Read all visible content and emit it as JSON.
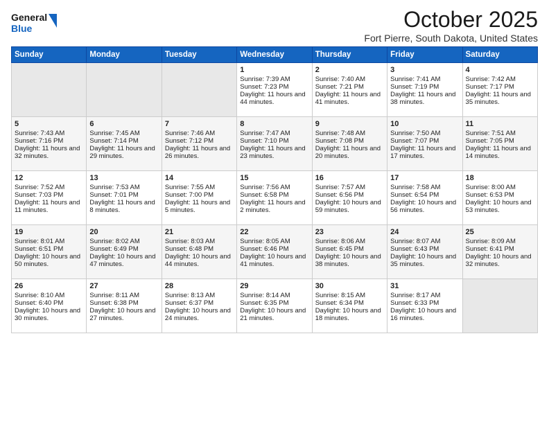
{
  "header": {
    "logo_general": "General",
    "logo_blue": "Blue",
    "month_title": "October 2025",
    "location": "Fort Pierre, South Dakota, United States"
  },
  "weekdays": [
    "Sunday",
    "Monday",
    "Tuesday",
    "Wednesday",
    "Thursday",
    "Friday",
    "Saturday"
  ],
  "weeks": [
    [
      {
        "day": "",
        "empty": true
      },
      {
        "day": "",
        "empty": true
      },
      {
        "day": "",
        "empty": true
      },
      {
        "day": "1",
        "sunrise": "Sunrise: 7:39 AM",
        "sunset": "Sunset: 7:23 PM",
        "daylight": "Daylight: 11 hours and 44 minutes."
      },
      {
        "day": "2",
        "sunrise": "Sunrise: 7:40 AM",
        "sunset": "Sunset: 7:21 PM",
        "daylight": "Daylight: 11 hours and 41 minutes."
      },
      {
        "day": "3",
        "sunrise": "Sunrise: 7:41 AM",
        "sunset": "Sunset: 7:19 PM",
        "daylight": "Daylight: 11 hours and 38 minutes."
      },
      {
        "day": "4",
        "sunrise": "Sunrise: 7:42 AM",
        "sunset": "Sunset: 7:17 PM",
        "daylight": "Daylight: 11 hours and 35 minutes."
      }
    ],
    [
      {
        "day": "5",
        "sunrise": "Sunrise: 7:43 AM",
        "sunset": "Sunset: 7:16 PM",
        "daylight": "Daylight: 11 hours and 32 minutes."
      },
      {
        "day": "6",
        "sunrise": "Sunrise: 7:45 AM",
        "sunset": "Sunset: 7:14 PM",
        "daylight": "Daylight: 11 hours and 29 minutes."
      },
      {
        "day": "7",
        "sunrise": "Sunrise: 7:46 AM",
        "sunset": "Sunset: 7:12 PM",
        "daylight": "Daylight: 11 hours and 26 minutes."
      },
      {
        "day": "8",
        "sunrise": "Sunrise: 7:47 AM",
        "sunset": "Sunset: 7:10 PM",
        "daylight": "Daylight: 11 hours and 23 minutes."
      },
      {
        "day": "9",
        "sunrise": "Sunrise: 7:48 AM",
        "sunset": "Sunset: 7:08 PM",
        "daylight": "Daylight: 11 hours and 20 minutes."
      },
      {
        "day": "10",
        "sunrise": "Sunrise: 7:50 AM",
        "sunset": "Sunset: 7:07 PM",
        "daylight": "Daylight: 11 hours and 17 minutes."
      },
      {
        "day": "11",
        "sunrise": "Sunrise: 7:51 AM",
        "sunset": "Sunset: 7:05 PM",
        "daylight": "Daylight: 11 hours and 14 minutes."
      }
    ],
    [
      {
        "day": "12",
        "sunrise": "Sunrise: 7:52 AM",
        "sunset": "Sunset: 7:03 PM",
        "daylight": "Daylight: 11 hours and 11 minutes."
      },
      {
        "day": "13",
        "sunrise": "Sunrise: 7:53 AM",
        "sunset": "Sunset: 7:01 PM",
        "daylight": "Daylight: 11 hours and 8 minutes."
      },
      {
        "day": "14",
        "sunrise": "Sunrise: 7:55 AM",
        "sunset": "Sunset: 7:00 PM",
        "daylight": "Daylight: 11 hours and 5 minutes."
      },
      {
        "day": "15",
        "sunrise": "Sunrise: 7:56 AM",
        "sunset": "Sunset: 6:58 PM",
        "daylight": "Daylight: 11 hours and 2 minutes."
      },
      {
        "day": "16",
        "sunrise": "Sunrise: 7:57 AM",
        "sunset": "Sunset: 6:56 PM",
        "daylight": "Daylight: 10 hours and 59 minutes."
      },
      {
        "day": "17",
        "sunrise": "Sunrise: 7:58 AM",
        "sunset": "Sunset: 6:54 PM",
        "daylight": "Daylight: 10 hours and 56 minutes."
      },
      {
        "day": "18",
        "sunrise": "Sunrise: 8:00 AM",
        "sunset": "Sunset: 6:53 PM",
        "daylight": "Daylight: 10 hours and 53 minutes."
      }
    ],
    [
      {
        "day": "19",
        "sunrise": "Sunrise: 8:01 AM",
        "sunset": "Sunset: 6:51 PM",
        "daylight": "Daylight: 10 hours and 50 minutes."
      },
      {
        "day": "20",
        "sunrise": "Sunrise: 8:02 AM",
        "sunset": "Sunset: 6:49 PM",
        "daylight": "Daylight: 10 hours and 47 minutes."
      },
      {
        "day": "21",
        "sunrise": "Sunrise: 8:03 AM",
        "sunset": "Sunset: 6:48 PM",
        "daylight": "Daylight: 10 hours and 44 minutes."
      },
      {
        "day": "22",
        "sunrise": "Sunrise: 8:05 AM",
        "sunset": "Sunset: 6:46 PM",
        "daylight": "Daylight: 10 hours and 41 minutes."
      },
      {
        "day": "23",
        "sunrise": "Sunrise: 8:06 AM",
        "sunset": "Sunset: 6:45 PM",
        "daylight": "Daylight: 10 hours and 38 minutes."
      },
      {
        "day": "24",
        "sunrise": "Sunrise: 8:07 AM",
        "sunset": "Sunset: 6:43 PM",
        "daylight": "Daylight: 10 hours and 35 minutes."
      },
      {
        "day": "25",
        "sunrise": "Sunrise: 8:09 AM",
        "sunset": "Sunset: 6:41 PM",
        "daylight": "Daylight: 10 hours and 32 minutes."
      }
    ],
    [
      {
        "day": "26",
        "sunrise": "Sunrise: 8:10 AM",
        "sunset": "Sunset: 6:40 PM",
        "daylight": "Daylight: 10 hours and 30 minutes."
      },
      {
        "day": "27",
        "sunrise": "Sunrise: 8:11 AM",
        "sunset": "Sunset: 6:38 PM",
        "daylight": "Daylight: 10 hours and 27 minutes."
      },
      {
        "day": "28",
        "sunrise": "Sunrise: 8:13 AM",
        "sunset": "Sunset: 6:37 PM",
        "daylight": "Daylight: 10 hours and 24 minutes."
      },
      {
        "day": "29",
        "sunrise": "Sunrise: 8:14 AM",
        "sunset": "Sunset: 6:35 PM",
        "daylight": "Daylight: 10 hours and 21 minutes."
      },
      {
        "day": "30",
        "sunrise": "Sunrise: 8:15 AM",
        "sunset": "Sunset: 6:34 PM",
        "daylight": "Daylight: 10 hours and 18 minutes."
      },
      {
        "day": "31",
        "sunrise": "Sunrise: 8:17 AM",
        "sunset": "Sunset: 6:33 PM",
        "daylight": "Daylight: 10 hours and 16 minutes."
      },
      {
        "day": "",
        "empty": true
      }
    ]
  ]
}
